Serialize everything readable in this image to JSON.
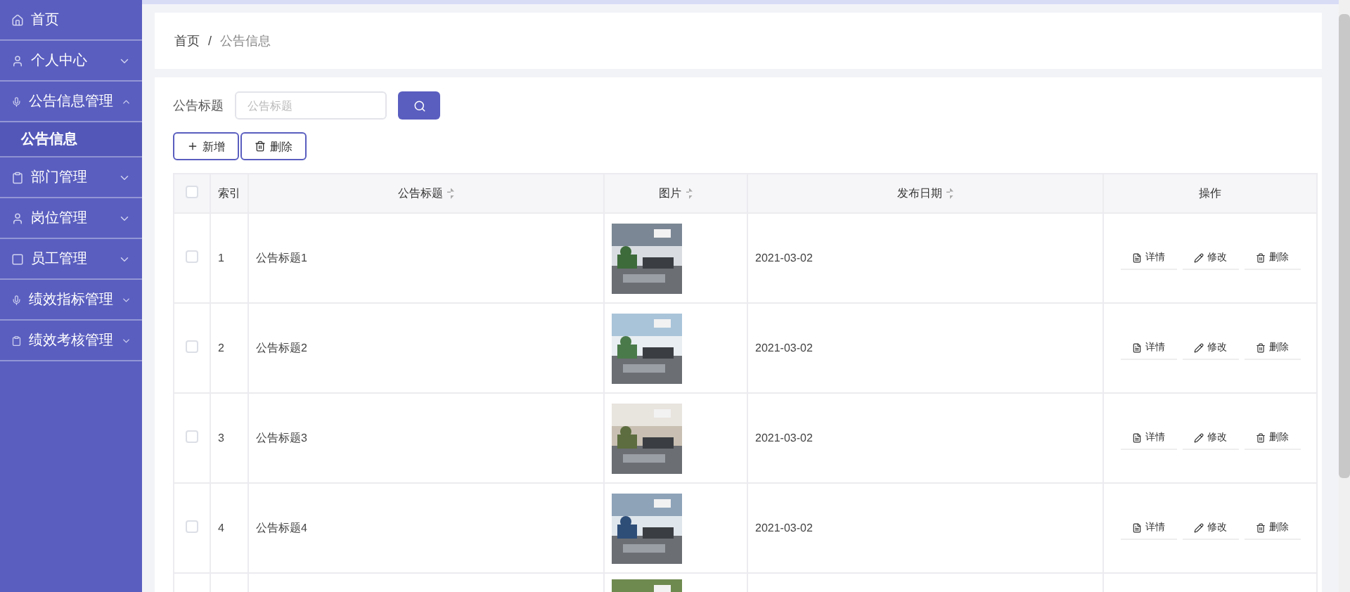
{
  "sidebar": {
    "items": [
      {
        "label": "首页",
        "kind": "link"
      },
      {
        "label": "个人中心",
        "kind": "group",
        "expanded": false
      },
      {
        "label": "公告信息管理",
        "kind": "group",
        "expanded": true,
        "children": [
          {
            "label": "公告信息",
            "selected": true
          }
        ]
      },
      {
        "label": "部门管理",
        "kind": "group",
        "expanded": false
      },
      {
        "label": "岗位管理",
        "kind": "group",
        "expanded": false
      },
      {
        "label": "员工管理",
        "kind": "group",
        "expanded": false
      },
      {
        "label": "绩效指标管理",
        "kind": "group",
        "expanded": false
      },
      {
        "label": "绩效考核管理",
        "kind": "group",
        "expanded": false
      }
    ]
  },
  "breadcrumb": [
    "首页",
    "公告信息"
  ],
  "breadcrumb_separator": "/",
  "search": {
    "label": "公告标题",
    "placeholder": "公告标题"
  },
  "toolbar": [
    {
      "kind": "add",
      "label": "新增"
    },
    {
      "kind": "delete",
      "label": "删除"
    }
  ],
  "table": {
    "header_checked": false,
    "columns": [
      {
        "kind": "check"
      },
      {
        "kind": "index",
        "label": "索引",
        "sortable": false
      },
      {
        "kind": "title",
        "label": "公告标题",
        "sortable": true
      },
      {
        "label": "图片",
        "sortable": true
      },
      {
        "kind": "date",
        "label": "发布日期",
        "sortable": true
      },
      {
        "kind": "actions",
        "label": "操作",
        "sortable": false
      }
    ],
    "rows": [
      {
        "checked": false,
        "index": "1",
        "title": "公告标题1",
        "image": {
          "kind": "picture"
        },
        "date": "2021-03-02",
        "actions": [
          {
            "kind": "detail",
            "label": "详情"
          },
          {
            "kind": "edit",
            "label": "修改"
          },
          {
            "kind": "delete",
            "label": "删除"
          }
        ]
      },
      {
        "checked": false,
        "index": "2",
        "title": "公告标题2",
        "image": {
          "kind": "picture"
        },
        "date": "2021-03-02",
        "actions": [
          {
            "kind": "detail",
            "label": "详情"
          },
          {
            "kind": "edit",
            "label": "修改"
          },
          {
            "kind": "delete",
            "label": "删除"
          }
        ]
      },
      {
        "checked": false,
        "index": "3",
        "title": "公告标题3",
        "image": {
          "kind": "picture"
        },
        "date": "2021-03-02",
        "actions": [
          {
            "kind": "detail",
            "label": "详情"
          },
          {
            "kind": "edit",
            "label": "修改"
          },
          {
            "kind": "delete",
            "label": "删除"
          }
        ]
      },
      {
        "checked": false,
        "index": "4",
        "title": "公告标题4",
        "image": {
          "kind": "picture"
        },
        "date": "2021-03-02",
        "actions": [
          {
            "kind": "detail",
            "label": "详情"
          },
          {
            "kind": "edit",
            "label": "修改"
          },
          {
            "kind": "delete",
            "label": "删除"
          }
        ]
      }
    ],
    "cut_off_row": {
      "image": {
        "kind": "picture"
      }
    }
  }
}
